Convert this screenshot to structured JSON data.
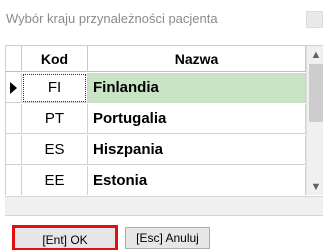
{
  "window": {
    "title": "Wybór kraju przynależności pacjenta"
  },
  "grid": {
    "columns": {
      "kod": "Kod",
      "nazwa": "Nazwa"
    },
    "rows": [
      {
        "kod": "FI",
        "nazwa": "Finlandia",
        "selected": true
      },
      {
        "kod": "PT",
        "nazwa": "Portugalia",
        "selected": false
      },
      {
        "kod": "ES",
        "nazwa": "Hiszpania",
        "selected": false
      },
      {
        "kod": "EE",
        "nazwa": "Estonia",
        "selected": false
      }
    ],
    "selection_color": "#c9e4c5"
  },
  "scrollbar": {
    "up_icon": "chevron-up-icon",
    "down_icon": "chevron-down-icon"
  },
  "buttons": {
    "ok_label": "[Ent] OK",
    "cancel_label": "[Esc] Anuluj"
  },
  "colors": {
    "focus_outline": "#e01010"
  }
}
